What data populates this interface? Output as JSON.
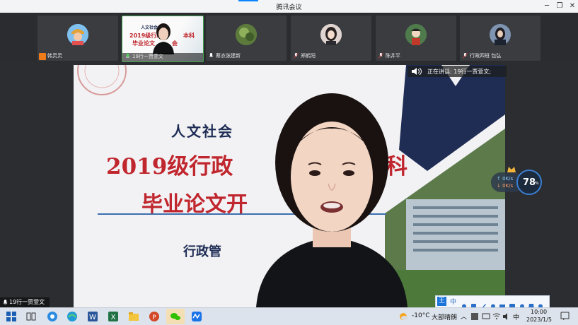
{
  "window": {
    "title": "腾讯会议",
    "minimize": "─",
    "maximize": "❐",
    "close": "✕"
  },
  "participants": [
    {
      "name": "韩灵灵",
      "avatar_color": "#74b6e6",
      "muted": false
    },
    {
      "name": "19行一贾萱文",
      "avatar_color": "#e8c0a8",
      "muted": false,
      "active": true
    },
    {
      "name": "蔡衣张建新",
      "avatar_color": "#6a8a4a",
      "muted": false
    },
    {
      "name": "郑鹤阳",
      "avatar_color": "#c4b7b4",
      "muted": true
    },
    {
      "name": "陈井平",
      "avatar_color": "#5b8a5a",
      "muted": true
    },
    {
      "name": "行政四班 包弘",
      "avatar_color": "#303848",
      "muted": true
    }
  ],
  "thumbnail_slide": {
    "line1": "人文社会",
    "line2": "2019级行政",
    "line2_suffix": "本科",
    "line3": "毕业论文",
    "line3_suffix": "会"
  },
  "speaking": {
    "label": "正在讲话: 19行一贾萱文;"
  },
  "slide": {
    "line1": "人文社会",
    "line2_a": "2019级行政",
    "line2_b": "本科",
    "line3_a": "毕业论文开",
    "line3_b": "会",
    "line4": "行政管"
  },
  "network": {
    "upload": "0K/s",
    "download": "0K/s",
    "percent": "78",
    "percent_unit": "%"
  },
  "current_speaker_tag": "19行一贾萱文",
  "ime": {
    "mode": "中",
    "brand": "王"
  },
  "taskbar": {
    "weather_temp": "-10°C",
    "weather_desc": "大部晴朗",
    "ime_lang": "中",
    "time": "10:00",
    "date": "2023/1/5"
  },
  "colors": {
    "accent": "#0a84ff",
    "slide_red": "#c0262d",
    "slide_navy": "#1f2d55",
    "network_blue": "#3b7fd2"
  }
}
